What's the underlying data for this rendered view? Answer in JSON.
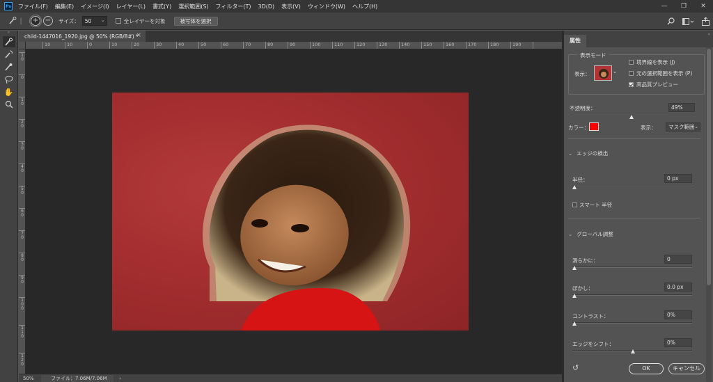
{
  "app": {
    "logo": "Ps"
  },
  "menu": [
    "ファイル(F)",
    "編集(E)",
    "イメージ(I)",
    "レイヤー(L)",
    "書式(Y)",
    "選択範囲(S)",
    "フィルター(T)",
    "3D(D)",
    "表示(V)",
    "ウィンドウ(W)",
    "ヘルプ(H)"
  ],
  "window_controls": [
    "—",
    "❐",
    "✕"
  ],
  "options": {
    "size_label": "サイズ：",
    "size_value": "50",
    "sample_all_layers": "全レイヤーを対象",
    "select_subject": "被写体を選択"
  },
  "document": {
    "tab_title": "child-1447016_1920.jpg @ 50% (RGB/8#) *",
    "close": "×"
  },
  "ruler_h": [
    "0",
    "10",
    "20",
    "30",
    "40",
    "50",
    "60",
    "70",
    "80",
    "90",
    "100",
    "110",
    "120",
    "130",
    "140",
    "150",
    "160",
    "170",
    "180",
    "190"
  ],
  "ruler_v": [
    "1",
    "0",
    "2",
    "0",
    "3",
    "0",
    "4",
    "0",
    "5",
    "0",
    "6",
    "0",
    "7",
    "0",
    "8",
    "0",
    "9",
    "0",
    "1",
    "0"
  ],
  "status": {
    "zoom": "50%",
    "file": "ファイル：7.06M/7.06M",
    "arrow": "›"
  },
  "panel": {
    "tab": "属性",
    "view_mode": {
      "title": "表示モード",
      "view_label": "表示：",
      "show_edges": "境界線を表示 (J)",
      "show_original": "元の選択範囲を表示 (P)",
      "high_quality": "高品質プレビュー",
      "show_edges_checked": false,
      "show_original_checked": false,
      "high_quality_checked": true
    },
    "opacity_label": "不透明度：",
    "opacity_value": "49%",
    "opacity_level": 0.49,
    "color_label": "カラー：",
    "color_value": "#ff0000",
    "display_label": "表示：",
    "display_value": "マスク範囲",
    "edge_detection": {
      "title": "エッジの検出",
      "radius_label": "半径：",
      "radius_value": "0 px",
      "smart_radius": "スマート 半径"
    },
    "global_refine": {
      "title": "グローバル調整",
      "smooth_label": "滑らかに：",
      "smooth_value": "0",
      "feather_label": "ぼかし：",
      "feather_value": "0.0 px",
      "contrast_label": "コントラスト：",
      "contrast_value": "0%",
      "shift_label": "エッジをシフト：",
      "shift_value": "0%"
    },
    "ok": "OK",
    "cancel": "キャンセル"
  }
}
